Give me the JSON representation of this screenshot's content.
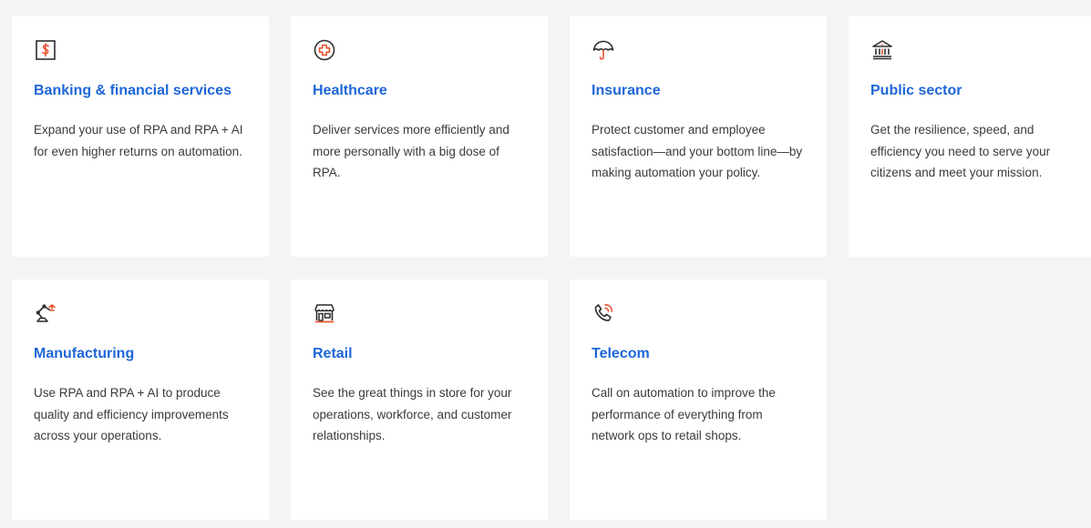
{
  "colors": {
    "heading": "#1e66d8",
    "icon_stroke": "#2d2d2d",
    "icon_accent": "#e8542f",
    "body_text": "#3a3a3a",
    "card_bg": "#ffffff",
    "page_bg": "#f4f4f4"
  },
  "cards": [
    {
      "icon": "dollar-sign-icon",
      "title": "Banking & financial services",
      "description": "Expand your use of RPA and RPA + AI for even higher returns on automation."
    },
    {
      "icon": "medical-cross-icon",
      "title": "Healthcare",
      "description": "Deliver services more efficiently and more personally with a big dose of RPA."
    },
    {
      "icon": "umbrella-icon",
      "title": "Insurance",
      "description": "Protect customer and employee satisfaction—and your bottom line—by making automation your policy."
    },
    {
      "icon": "government-building-icon",
      "title": "Public sector",
      "description": "Get the resilience, speed, and efficiency you need to serve your citizens and meet your mission."
    },
    {
      "icon": "robotic-arm-icon",
      "title": "Manufacturing",
      "description": "Use RPA and RPA + AI to produce quality and efficiency improvements across your operations."
    },
    {
      "icon": "storefront-icon",
      "title": "Retail",
      "description": "See the great things in store for your operations, workforce, and customer relationships."
    },
    {
      "icon": "phone-signal-icon",
      "title": "Telecom",
      "description": "Call on automation to improve the performance of everything from network ops to retail shops."
    }
  ]
}
